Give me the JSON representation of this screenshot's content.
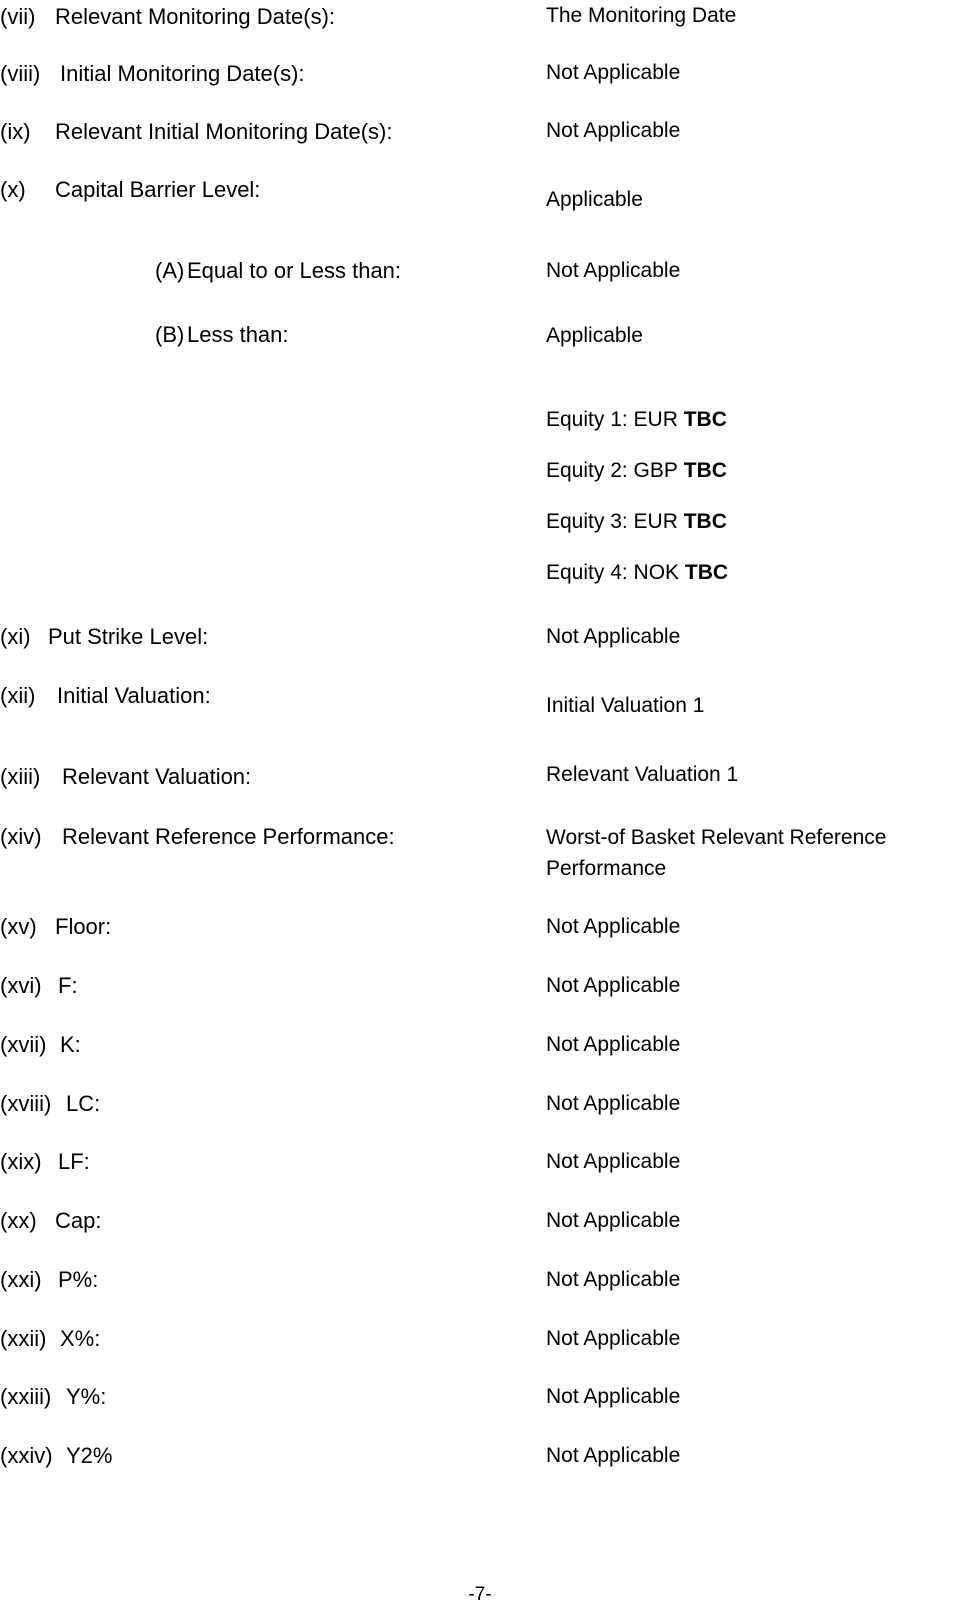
{
  "document": {
    "page_number_label": "-7-"
  },
  "rows": [
    {
      "numeral": "(vii)",
      "label": "Relevant Monitoring Date(s):",
      "value": "The Monitoring Date"
    },
    {
      "numeral": "(viii)",
      "label": "Initial Monitoring Date(s):",
      "value": "Not Applicable"
    },
    {
      "numeral": "(ix)",
      "label": "Relevant Initial Monitoring Date(s):",
      "value": "Not Applicable"
    },
    {
      "numeral": "(x)",
      "label": "Capital Barrier Level:",
      "value": "Applicable"
    },
    {
      "numeral": "(xi)",
      "label": "Put Strike Level:",
      "value": "Not Applicable"
    },
    {
      "numeral": "(xii)",
      "label": "Initial Valuation:",
      "value": "Initial Valuation 1"
    },
    {
      "numeral": "(xiii)",
      "label": "Relevant Valuation:",
      "value": "Relevant Valuation 1"
    },
    {
      "numeral": "(xiv)",
      "label": "Relevant Reference Performance:",
      "value": "Worst-of Basket Relevant Reference Performance"
    },
    {
      "numeral": "(xv)",
      "label": "Floor:",
      "value": "Not Applicable"
    },
    {
      "numeral": "(xvi)",
      "label": "F:",
      "value": "Not Applicable"
    },
    {
      "numeral": "(xvii)",
      "label": "K:",
      "value": "Not Applicable"
    },
    {
      "numeral": "(xviii)",
      "label": "LC:",
      "value": "Not Applicable"
    },
    {
      "numeral": "(xix)",
      "label": "LF:",
      "value": "Not Applicable"
    },
    {
      "numeral": "(xx)",
      "label": "Cap:",
      "value": "Not Applicable"
    },
    {
      "numeral": "(xxi)",
      "label": "P%:",
      "value": "Not Applicable"
    },
    {
      "numeral": "(xxii)",
      "label": "X%:",
      "value": "Not Applicable"
    },
    {
      "numeral": "(xxiii)",
      "label": "Y%:",
      "value": "Not Applicable"
    },
    {
      "numeral": "(xxiv)",
      "label": "Y2%",
      "value": "Not Applicable"
    }
  ],
  "sub_rows": [
    {
      "marker": "(A)",
      "label": "Equal to or Less than:",
      "value": "Not Applicable"
    },
    {
      "marker": "(B)",
      "label": "Less than:",
      "value": "Applicable"
    }
  ],
  "equity_levels": [
    {
      "prefix": "Equity 1: EUR",
      "amount": "TBC"
    },
    {
      "prefix": "Equity 2: GBP",
      "amount": "TBC"
    },
    {
      "prefix": "Equity 3: EUR",
      "amount": "TBC"
    },
    {
      "prefix": "Equity 4: NOK",
      "amount": "TBC"
    }
  ]
}
